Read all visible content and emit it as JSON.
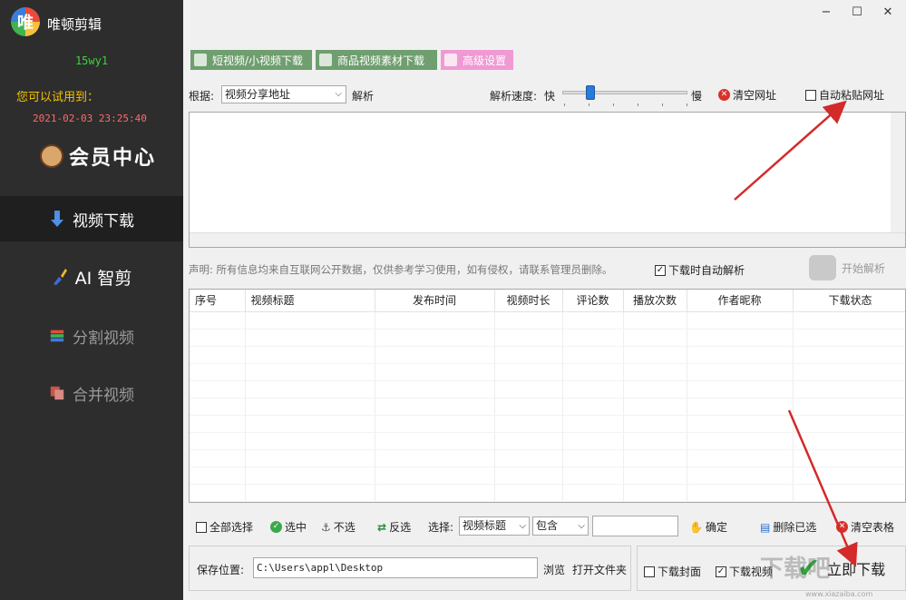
{
  "app": {
    "title": "唯顿剪辑",
    "logo_text": "唯"
  },
  "sidebar": {
    "username": "15wy1",
    "trial_label": "您可以试用到：",
    "trial_date": "2021-02-03 23:25:40",
    "member_center": "会员中心",
    "items": [
      {
        "label": "视频下载",
        "active": true
      },
      {
        "label": "AI 智剪",
        "active": false
      },
      {
        "label": "分割视频",
        "active": false
      },
      {
        "label": "合并视频",
        "active": false
      }
    ]
  },
  "window": {
    "min": "−",
    "max": "☐",
    "close": "✕"
  },
  "toolbar": {
    "short_video": "短视频/小视频下载",
    "product_video": "商品视频素材下载",
    "advanced": "高级设置"
  },
  "parse": {
    "basis_label": "根据:",
    "basis_value": "视频分享地址",
    "parse_label": "解析",
    "speed_label": "解析速度:",
    "speed_fast": "快",
    "speed_slow": "慢",
    "speed_level": 0.25,
    "clear_url": "清空网址",
    "auto_paste": "自动粘贴网址",
    "auto_paste_checked": false
  },
  "notice": {
    "text": "声明: 所有信息均来自互联网公开数据，仅供参考学习使用，如有侵权，请联系管理员删除。",
    "auto_parse_download": "下载时自动解析",
    "auto_parse_checked": true,
    "start_parse": "开始解析"
  },
  "table": {
    "columns": [
      "序号",
      "视频标题",
      "发布时间",
      "视频时长",
      "评论数",
      "播放次数",
      "作者昵称",
      "下载状态"
    ],
    "rows": []
  },
  "selection": {
    "select_all": "全部选择",
    "select": "选中",
    "deselect": "不选",
    "invert": "反选",
    "select_label": "选择:",
    "field_value": "视频标题",
    "match_value": "包含",
    "filter_value": "",
    "confirm": "确定",
    "delete_selected": "删除已选",
    "clear_table": "清空表格"
  },
  "save": {
    "label": "保存位置:",
    "path": "C:\\Users\\appl\\Desktop",
    "browse": "浏览",
    "open_folder": "打开文件夹"
  },
  "download": {
    "cover": "下载封面",
    "cover_checked": false,
    "video": "下载视频",
    "video_checked": true,
    "download_now": "立即下载"
  },
  "watermark": {
    "text": "下载吧",
    "url": "www.xiazaiba.com"
  },
  "colors": {
    "sidebar_bg": "#2d2d2d",
    "username": "#3cd33c",
    "trial_label": "#f2c200",
    "trial_date": "#ff6a6a",
    "arrow": "#d32a2a"
  }
}
